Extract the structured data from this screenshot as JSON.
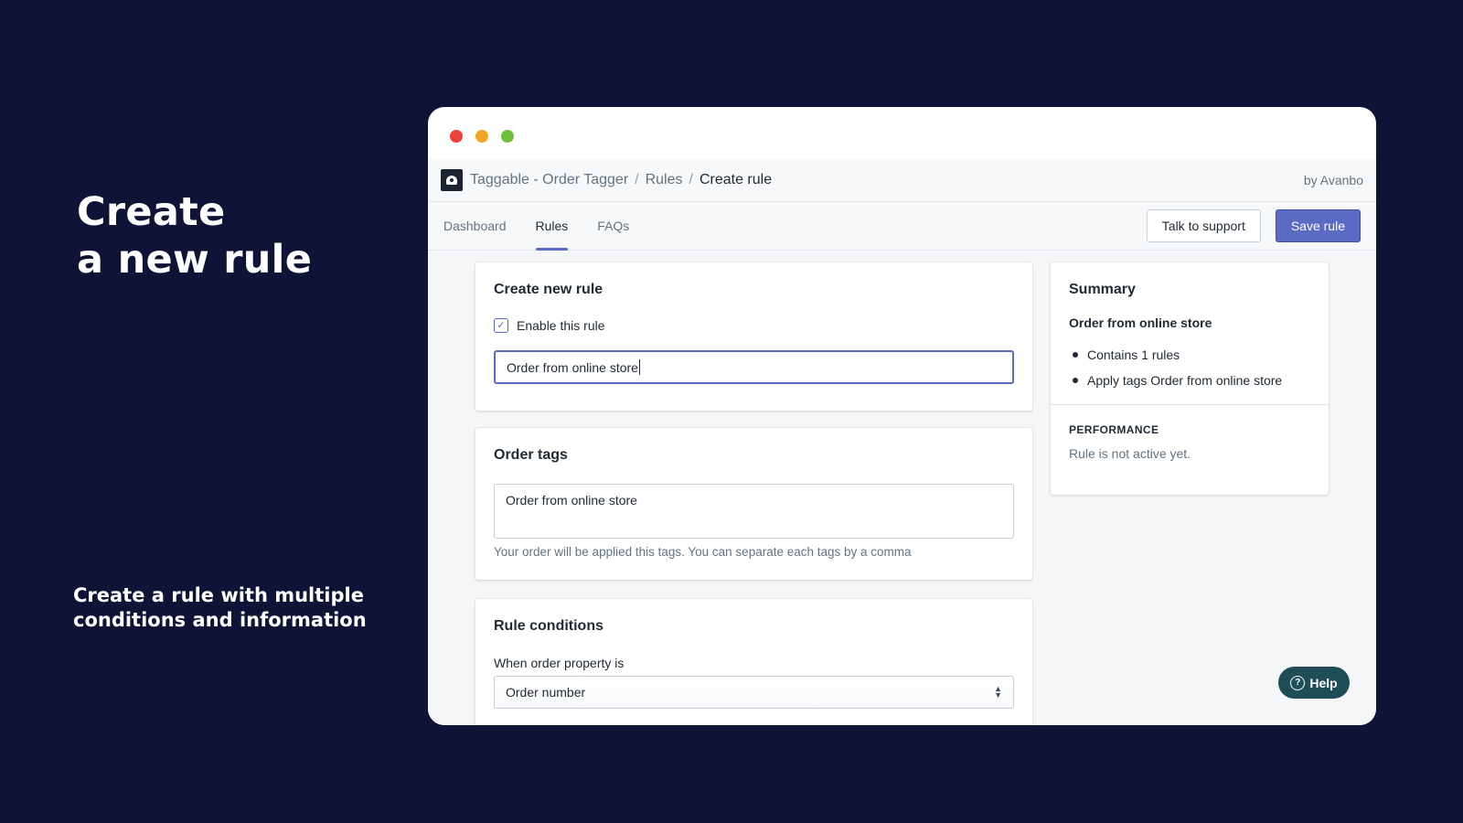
{
  "promo": {
    "title_line1": "Create",
    "title_line2": "a new rule",
    "subtitle": "Create a rule with multiple conditions and information"
  },
  "header": {
    "app_name": "Taggable - Order Tagger",
    "crumb_rules": "Rules",
    "crumb_current": "Create rule",
    "byline": "by Avanbo",
    "separator": "/"
  },
  "nav": {
    "tabs": [
      {
        "label": "Dashboard",
        "active": false
      },
      {
        "label": "Rules",
        "active": true
      },
      {
        "label": "FAQs",
        "active": false
      }
    ],
    "support_label": "Talk to support",
    "save_label": "Save rule"
  },
  "create_rule": {
    "title": "Create new rule",
    "enable_label": "Enable this rule",
    "enabled": true,
    "name_value": "Order from online store"
  },
  "order_tags": {
    "title": "Order tags",
    "value": "Order from online store",
    "help": "Your order will be applied this tags. You can separate each tags by a comma"
  },
  "rule_conditions": {
    "title": "Rule conditions",
    "label": "When order property is",
    "selected": "Order number"
  },
  "summary": {
    "title": "Summary",
    "rule_name": "Order from online store",
    "items": [
      "Contains 1 rules",
      "Apply tags Order from online store"
    ],
    "performance_heading": "PERFORMANCE",
    "performance_text": "Rule is not active yet."
  },
  "help_button": {
    "label": "Help"
  },
  "colors": {
    "background": "#0f1437",
    "primary": "#5c6ac4",
    "help": "#1e4d57"
  }
}
